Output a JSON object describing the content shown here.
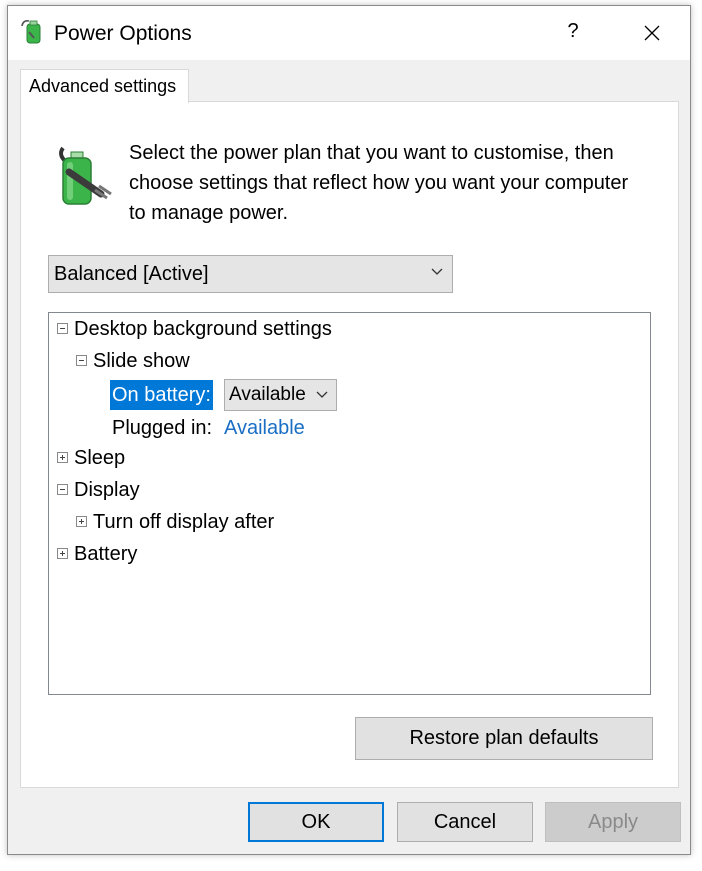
{
  "window": {
    "title": "Power Options",
    "help_label": "?",
    "close_icon": "close-icon"
  },
  "tab": {
    "label": "Advanced settings"
  },
  "description": "Select the power plan that you want to customise, then choose settings that reflect how you want your computer to manage power.",
  "plan": {
    "selected": "Balanced [Active]"
  },
  "tree": {
    "desktop_background": "Desktop background settings",
    "slide_show": "Slide show",
    "on_battery_label": "On battery:",
    "on_battery_value": "Available",
    "plugged_in_label": "Plugged in:",
    "plugged_in_value": "Available",
    "sleep": "Sleep",
    "display": "Display",
    "turn_off_display": "Turn off display after",
    "battery": "Battery"
  },
  "buttons": {
    "restore": "Restore plan defaults",
    "ok": "OK",
    "cancel": "Cancel",
    "apply": "Apply"
  },
  "colors": {
    "selection": "#0078d7",
    "link": "#1a6fc4",
    "battery_green": "#3bb54a"
  }
}
